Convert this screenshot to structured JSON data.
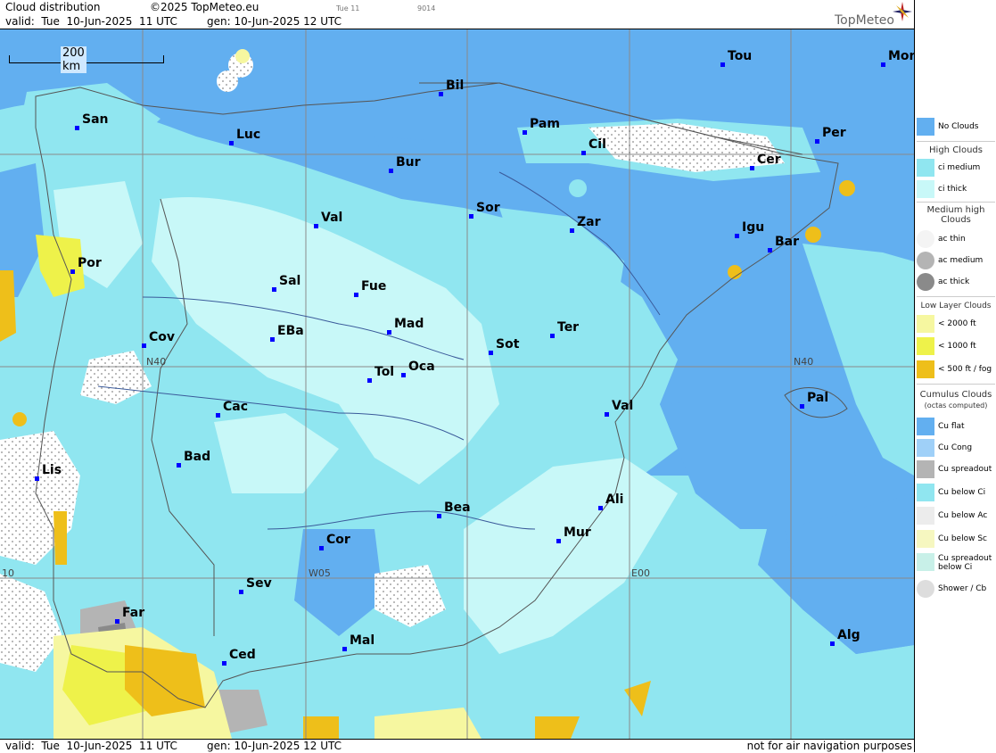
{
  "header": {
    "title": "Cloud distribution",
    "copyright": "©2025 TopMeteo.eu",
    "tab": "Tue 11",
    "code": "9014",
    "valid": "valid:  Tue  10-Jun-2025  11 UTC",
    "gen": "gen: 10-Jun-2025 12 UTC",
    "brand": "TopMeteo"
  },
  "map": {
    "scale_label": "200 km",
    "grid_labels": [
      "N40",
      "N40",
      "W05",
      "E00",
      "10"
    ],
    "cities": [
      "Tou",
      "Mon",
      "San",
      "Luc",
      "Bil",
      "Pam",
      "Cil",
      "Per",
      "Cer",
      "Bur",
      "Sor",
      "Zar",
      "Igu",
      "Bar",
      "Val",
      "Por",
      "Sal",
      "Fue",
      "Mad",
      "Ter",
      "EBa",
      "Cov",
      "Sot",
      "Tol",
      "Oca",
      "Pal",
      "Cac",
      "Val",
      "Bad",
      "Lis",
      "Bea",
      "Ali",
      "Mur",
      "Cor",
      "Sev",
      "Far",
      "Mal",
      "Ced",
      "Alg"
    ]
  },
  "footer": {
    "valid": "valid:  Tue  10-Jun-2025  11 UTC",
    "gen": "gen: 10-Jun-2025 12 UTC",
    "notice": "not for air navigation purposes"
  },
  "legend": {
    "no_clouds": "No Clouds",
    "high_head": "High Clouds",
    "ci_medium": "ci medium",
    "ci_thick": "ci thick",
    "medium_head": "Medium high Clouds",
    "ac_thin": "ac thin",
    "ac_medium": "ac medium",
    "ac_thick": "ac thick",
    "low_head": "Low Layer Clouds",
    "low1": "< 2000 ft",
    "low2": "< 1000 ft",
    "low3": "< 500 ft / fog",
    "cu_head": "Cumulus Clouds",
    "cu_sub": "(octas computed)",
    "cu_flat": "Cu flat",
    "cu_cong": "Cu Cong",
    "cu_spread": "Cu spreadout",
    "cu_below_ci": "Cu below Ci",
    "cu_below_ac": "Cu below Ac",
    "cu_below_sc": "Cu below Sc",
    "cu_spread_below_ci": "Cu spreadout below Ci",
    "shower": "Shower / Cb"
  },
  "colors": {
    "no_clouds": "#62aff0",
    "ci_medium": "#90e6f0",
    "ci_thick": "#c8f8f8",
    "low_2000": "#f6f7a0",
    "low_1000": "#eef24a",
    "fog": "#eebf1a",
    "ac_medium": "#b4b4b4",
    "ac_thick": "#8a8a8a"
  }
}
